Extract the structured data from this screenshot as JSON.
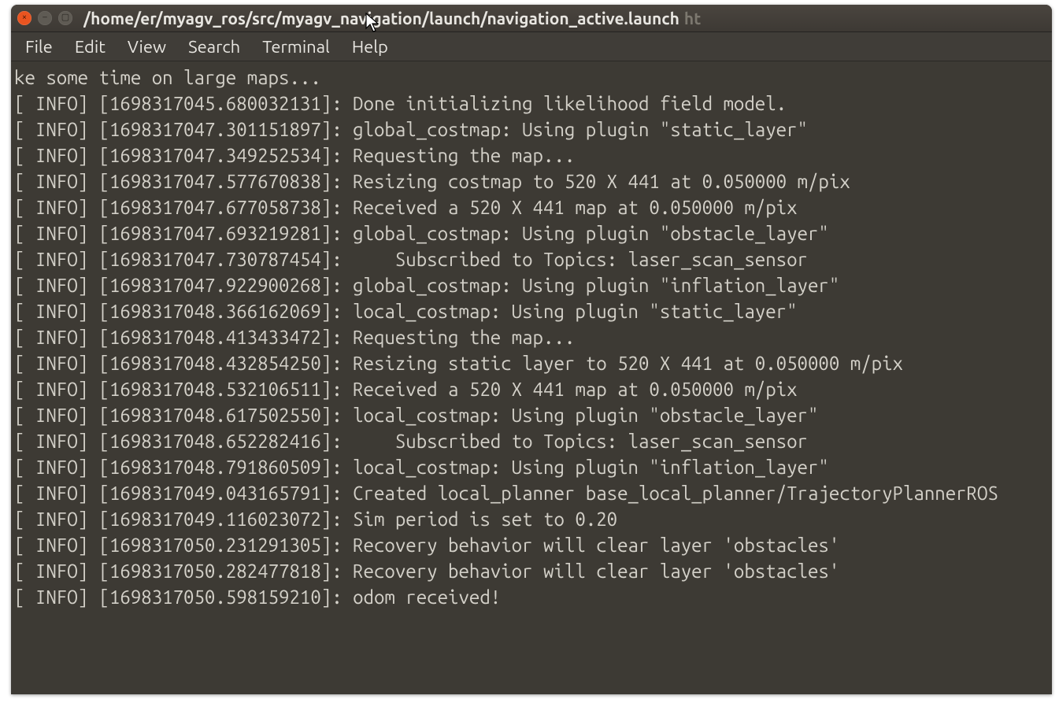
{
  "window": {
    "title_main": "/home/er/myagv_ros/src/myagv_navigation/launch/navigation_active.launch",
    "title_dim": "ht"
  },
  "menubar": {
    "items": [
      "File",
      "Edit",
      "View",
      "Search",
      "Terminal",
      "Help"
    ]
  },
  "terminal": {
    "lines": [
      "ke some time on large maps...",
      "[ INFO] [1698317045.680032131]: Done initializing likelihood field model.",
      "[ INFO] [1698317047.301151897]: global_costmap: Using plugin \"static_layer\"",
      "[ INFO] [1698317047.349252534]: Requesting the map...",
      "[ INFO] [1698317047.577670838]: Resizing costmap to 520 X 441 at 0.050000 m/pix",
      "[ INFO] [1698317047.677058738]: Received a 520 X 441 map at 0.050000 m/pix",
      "[ INFO] [1698317047.693219281]: global_costmap: Using plugin \"obstacle_layer\"",
      "[ INFO] [1698317047.730787454]:     Subscribed to Topics: laser_scan_sensor",
      "[ INFO] [1698317047.922900268]: global_costmap: Using plugin \"inflation_layer\"",
      "[ INFO] [1698317048.366162069]: local_costmap: Using plugin \"static_layer\"",
      "[ INFO] [1698317048.413433472]: Requesting the map...",
      "[ INFO] [1698317048.432854250]: Resizing static layer to 520 X 441 at 0.050000 m/pix",
      "[ INFO] [1698317048.532106511]: Received a 520 X 441 map at 0.050000 m/pix",
      "[ INFO] [1698317048.617502550]: local_costmap: Using plugin \"obstacle_layer\"",
      "[ INFO] [1698317048.652282416]:     Subscribed to Topics: laser_scan_sensor",
      "[ INFO] [1698317048.791860509]: local_costmap: Using plugin \"inflation_layer\"",
      "[ INFO] [1698317049.043165791]: Created local_planner base_local_planner/TrajectoryPlannerROS",
      "[ INFO] [1698317049.116023072]: Sim period is set to 0.20",
      "[ INFO] [1698317050.231291305]: Recovery behavior will clear layer 'obstacles'",
      "[ INFO] [1698317050.282477818]: Recovery behavior will clear layer 'obstacles'",
      "[ INFO] [1698317050.598159210]: odom received!"
    ]
  }
}
